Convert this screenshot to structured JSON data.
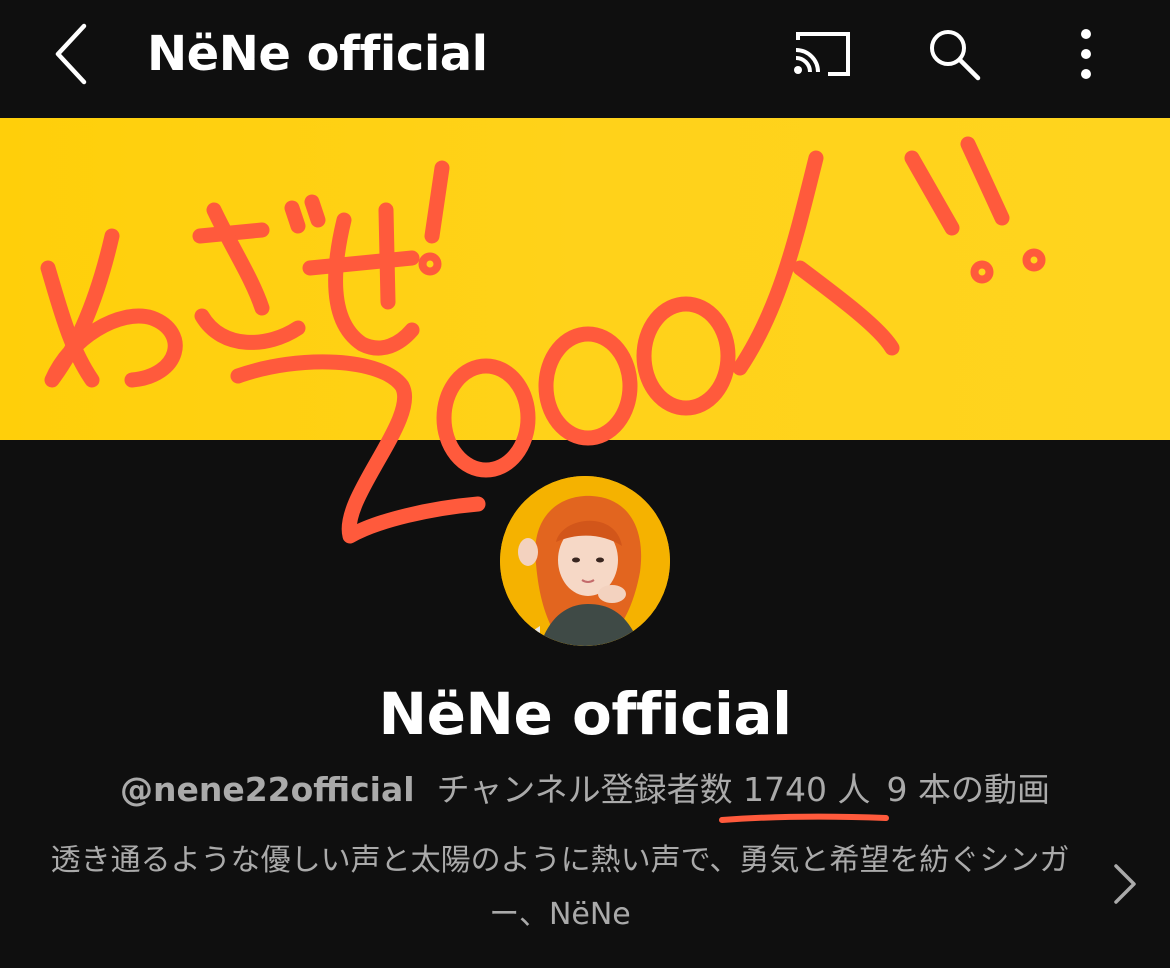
{
  "header": {
    "title": "NëNe official",
    "icons": [
      "back-chevron-icon",
      "cast-icon",
      "search-icon",
      "more-vertical-icon"
    ]
  },
  "banner": {
    "background_color": "#ffcf0a",
    "handwriting_color": "#ff5a3c",
    "handwritten_text": "めざせ! 2000人!!"
  },
  "channel": {
    "name": "NëNe official",
    "handle": "@nene22official",
    "subscribers_text": "チャンネル登録者数 1740 人",
    "videos_text": "9 本の動画",
    "description": "透き通るような優しい声と太陽のように熱い声で、勇気と希望を紡ぐシンガー、NëNe"
  },
  "colors": {
    "background": "#0f0f0f",
    "text_primary": "#ffffff",
    "text_secondary": "#aaaaaa",
    "accent_underline": "#ff5a3c"
  }
}
